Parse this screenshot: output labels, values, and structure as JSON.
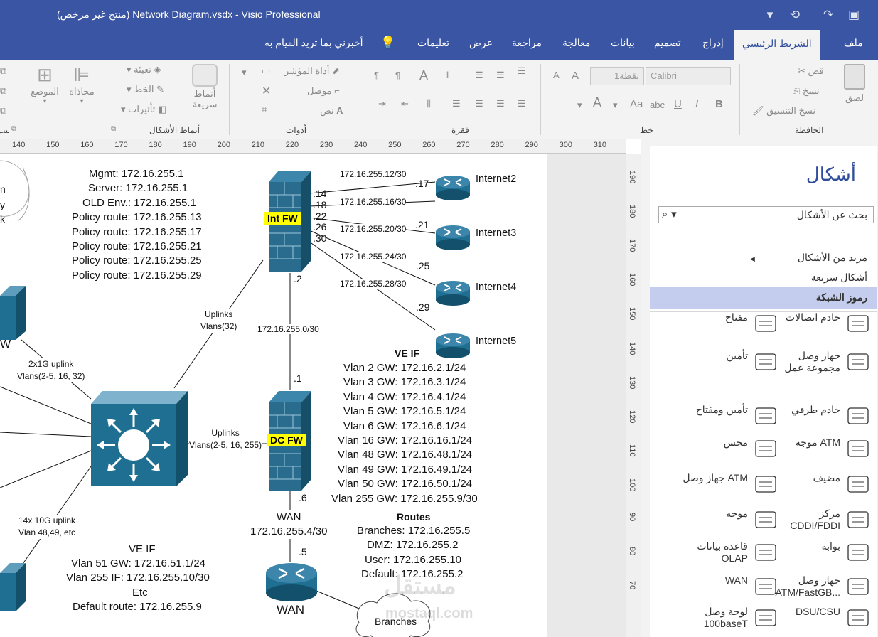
{
  "titlebar": {
    "title": "(منتج غير مرخص)  Network Diagram.vsdx  -  Visio Professional",
    "icons": [
      "customize-icon",
      "redo-icon",
      "undo-icon",
      "save-icon"
    ]
  },
  "tabs": [
    "ملف",
    "الشريط الرئيسي",
    "إدراج",
    "تصميم",
    "بيانات",
    "معالجة",
    "مراجعة",
    "عرض",
    "تعليمات"
  ],
  "tell_me": "أخبرني بما تريد القيام به",
  "ribbon": {
    "groups": {
      "clipboard": "الحافظة",
      "font": "خط",
      "paragraph": "فقرة",
      "tools": "أدوات",
      "shape_styles": "أنماط الأشكال",
      "arrange": "ترتيب"
    },
    "paste": "لصق",
    "cut": "قص",
    "copy": "نسخ",
    "format_painter": "نسخ التنسيق",
    "font_name": "Calibri",
    "font_size": "1نقطة",
    "pointer_tool": "أداة المؤشر",
    "connector": "موصل",
    "text": "نص",
    "fill": "تعبئة",
    "line": "الخط",
    "effects": "تأثيرات",
    "quick_styles": "أنماط سريعة",
    "align": "محاذاة",
    "position": "الموضع"
  },
  "ruler": {
    "top": [
      "140",
      "150",
      "160",
      "170",
      "180",
      "190",
      "200",
      "210",
      "220",
      "230",
      "240",
      "250",
      "260",
      "270",
      "280",
      "290",
      "300",
      "310"
    ],
    "left": [
      "190",
      "180",
      "170",
      "160",
      "150",
      "140",
      "130",
      "120",
      "110",
      "100",
      "90",
      "80",
      "70"
    ]
  },
  "shapes_pane": {
    "title": "أشكال",
    "search_placeholder": "بحث عن الأشكال",
    "more_shapes": "مزيد من الأشكال",
    "quick_shapes": "أشكال سريعة",
    "stencil": "رموز الشبكة",
    "items": [
      {
        "label": "خادم اتصالات",
        "icon": "comms-server-icon"
      },
      {
        "label": "مفتاح",
        "icon": "key-icon"
      },
      {
        "label": "جهاز وصل مجموعة عمل",
        "icon": "workgroup-hub-icon"
      },
      {
        "label": "تأمين",
        "icon": "lock-icon"
      },
      {
        "label": "خادم طرفي",
        "icon": "terminal-server-icon"
      },
      {
        "label": "تأمين ومفتاح",
        "icon": "lock-key-icon"
      },
      {
        "label": "موجه ATM",
        "icon": "atm-router-icon"
      },
      {
        "label": "مجس",
        "icon": "probe-icon"
      },
      {
        "label": "مضيف",
        "icon": "host-icon"
      },
      {
        "label": "جهاز وصل ATM",
        "icon": "atm-hub-icon"
      },
      {
        "label": "مركز CDDI/FDDI",
        "icon": "fddi-icon"
      },
      {
        "label": "موجه",
        "icon": "router-icon"
      },
      {
        "label": "بوابة",
        "icon": "gateway-icon"
      },
      {
        "label": "قاعدة بيانات OLAP",
        "icon": "olap-icon"
      },
      {
        "label": "جهاز وصل ATM/FastGB...",
        "icon": "fastgb-hub-icon"
      },
      {
        "label": "WAN",
        "icon": "wan-icon"
      },
      {
        "label": "DSU/CSU",
        "icon": "dsu-icon"
      },
      {
        "label": "لوحة وصل 100baseT",
        "icon": "patch-panel-icon"
      }
    ]
  },
  "diagram": {
    "top_left_text": [
      "Mgmt: 172.16.255.1",
      "Server: 172.16.255.1",
      "OLD Env.: 172.16.255.1",
      "Policy route: 172.16.255.13",
      "Policy route: 172.16.255.17",
      "Policy route: 172.16.255.21",
      "Policy route: 172.16.255.25",
      "Policy route: 172.16.255.29"
    ],
    "partial_left_top": [
      "n",
      "y",
      "k"
    ],
    "int_fw": "Int FW",
    "dc_fw": "DC FW",
    "fw_ports": [
      ".14",
      ".18",
      ".22",
      ".26",
      ".30"
    ],
    "links": [
      "172.16.255.12/30",
      "172.16.255.16/30",
      "172.16.255.20/30",
      "172.16.255.24/30",
      "172.16.255.28/30"
    ],
    "router_ports": [
      ".17",
      ".21",
      ".25",
      ".29"
    ],
    "internets": [
      "Internet2",
      "Internet3",
      "Internet4",
      "Internet5"
    ],
    "int_fw_bottom": ".2",
    "core_link": "172.16.255.0/30",
    "dc_fw_top": ".1",
    "uplinks1": [
      "Uplinks",
      "Vlans(32)"
    ],
    "uplinks2": [
      "Uplinks",
      "Vlans(2-5, 16, 255)"
    ],
    "left_label_w": "W",
    "uplink_2x": [
      "2x1G uplink",
      "Vlans(2-5, 16, 32)"
    ],
    "uplink_14x": [
      "14x 10G uplink",
      "Vlan 48,49, etc"
    ],
    "ve_if_title": "VE IF",
    "ve_if": [
      "Vlan 2 GW: 172.16.2.1/24",
      "Vlan 3 GW: 172.16.3.1/24",
      "Vlan 4 GW: 172.16.4.1/24",
      "Vlan 5 GW: 172.16.5.1/24",
      "Vlan 6 GW: 172.16.6.1/24",
      "Vlan 16 GW: 172.16.16.1/24",
      "Vlan 48 GW: 172.16.48.1/24",
      "Vlan 49 GW: 172.16.49.1/24",
      "Vlan 50 GW: 172.16.50.1/24",
      "Vlan 255 GW: 172.16.255.9/30"
    ],
    "dc_fw_bottom": ".6",
    "wan_link": [
      "WAN",
      "172.16.255.4/30"
    ],
    "wan_port": ".5",
    "wan_router": "WAN",
    "routes_title": "Routes",
    "routes": [
      "Branches: 172.16.255.5",
      "DMZ: 172.16.255.2",
      "User: 172.16.255.10",
      "Default: 172.16.255.2"
    ],
    "ve_if2_title": "VE IF",
    "ve_if2": [
      "Vlan 51 GW: 172.16.51.1/24",
      "Vlan 255 IF: 172.16.255.10/30",
      "Etc",
      "Default route: 172.16.255.9"
    ],
    "branches": "Branches",
    "watermark": [
      "مستقل",
      "mostaql.com"
    ]
  },
  "colors": {
    "accent": "#3955a3",
    "device": "#1f6f92",
    "firewall": "#2a6c8e"
  }
}
